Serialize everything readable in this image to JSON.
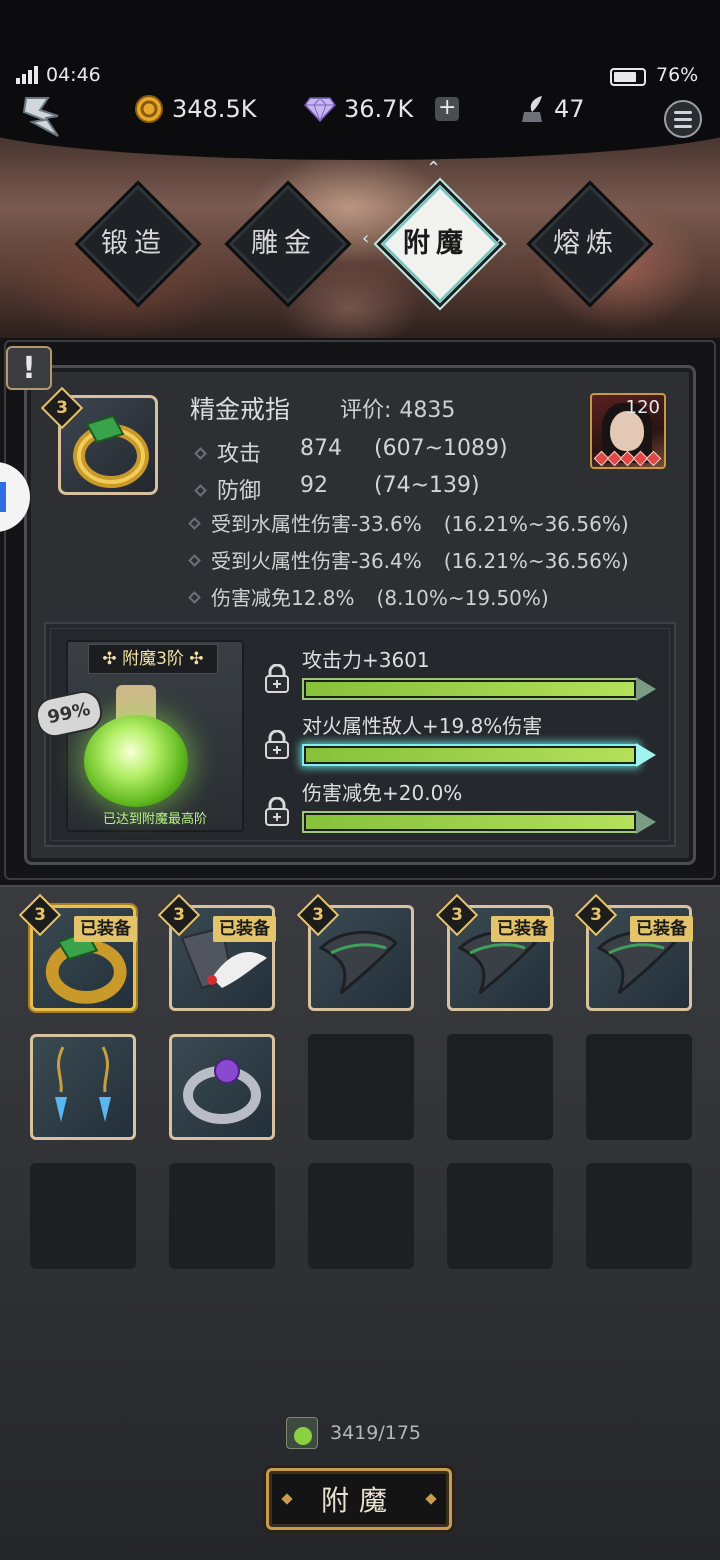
{
  "status": {
    "time": "04:46",
    "battery": "76%"
  },
  "resources": {
    "gold": "348.5K",
    "gems": "36.7K",
    "ink": "47"
  },
  "tabs": [
    {
      "label": "锻造"
    },
    {
      "label": "雕金"
    },
    {
      "label": "附魔"
    },
    {
      "label": "熔炼"
    }
  ],
  "active_tab": "附魔",
  "item": {
    "tier": "3",
    "name": "精金戒指",
    "score_label": "评价:",
    "score": "4835",
    "hero_level": "120",
    "stats": [
      {
        "name": "攻击",
        "value": "874",
        "range": "(607~1089)"
      },
      {
        "name": "防御",
        "value": "92",
        "range": "(74~139)"
      }
    ],
    "sub_stats": [
      {
        "text": "受到水属性伤害-33.6%",
        "range": "(16.21%~36.56%)"
      },
      {
        "text": "受到火属性伤害-36.4%",
        "range": "(16.21%~36.56%)"
      },
      {
        "text": "伤害减免12.8%",
        "range": "(8.10%~19.50%)"
      }
    ]
  },
  "enchant": {
    "level_label": "附魔3阶",
    "percent": "99%",
    "footer": "已达到附魔最高阶",
    "lines": [
      {
        "text": "攻击力+3601",
        "progress": 1.0
      },
      {
        "text": "对火属性敌人+19.8%伤害",
        "progress": 1.0
      },
      {
        "text": "伤害减免+20.0%",
        "progress": 1.0
      }
    ]
  },
  "inventory": {
    "equipped_label": "已装备",
    "items": [
      {
        "tier": "3",
        "icon": "ring-icon",
        "equipped": true,
        "selected": true
      },
      {
        "tier": "3",
        "icon": "wing-armor-icon",
        "equipped": true,
        "selected": false
      },
      {
        "tier": "3",
        "icon": "horn-icon",
        "equipped": false,
        "selected": false
      },
      {
        "tier": "3",
        "icon": "horn-icon",
        "equipped": true,
        "selected": false
      },
      {
        "tier": "3",
        "icon": "horn-icon",
        "equipped": true,
        "selected": false
      },
      {
        "tier": "",
        "icon": "earrings-icon",
        "equipped": false,
        "selected": false
      },
      {
        "tier": "",
        "icon": "bracelet-icon",
        "equipped": false,
        "selected": false
      }
    ]
  },
  "cost": "3419/175",
  "action_button": "附魔"
}
